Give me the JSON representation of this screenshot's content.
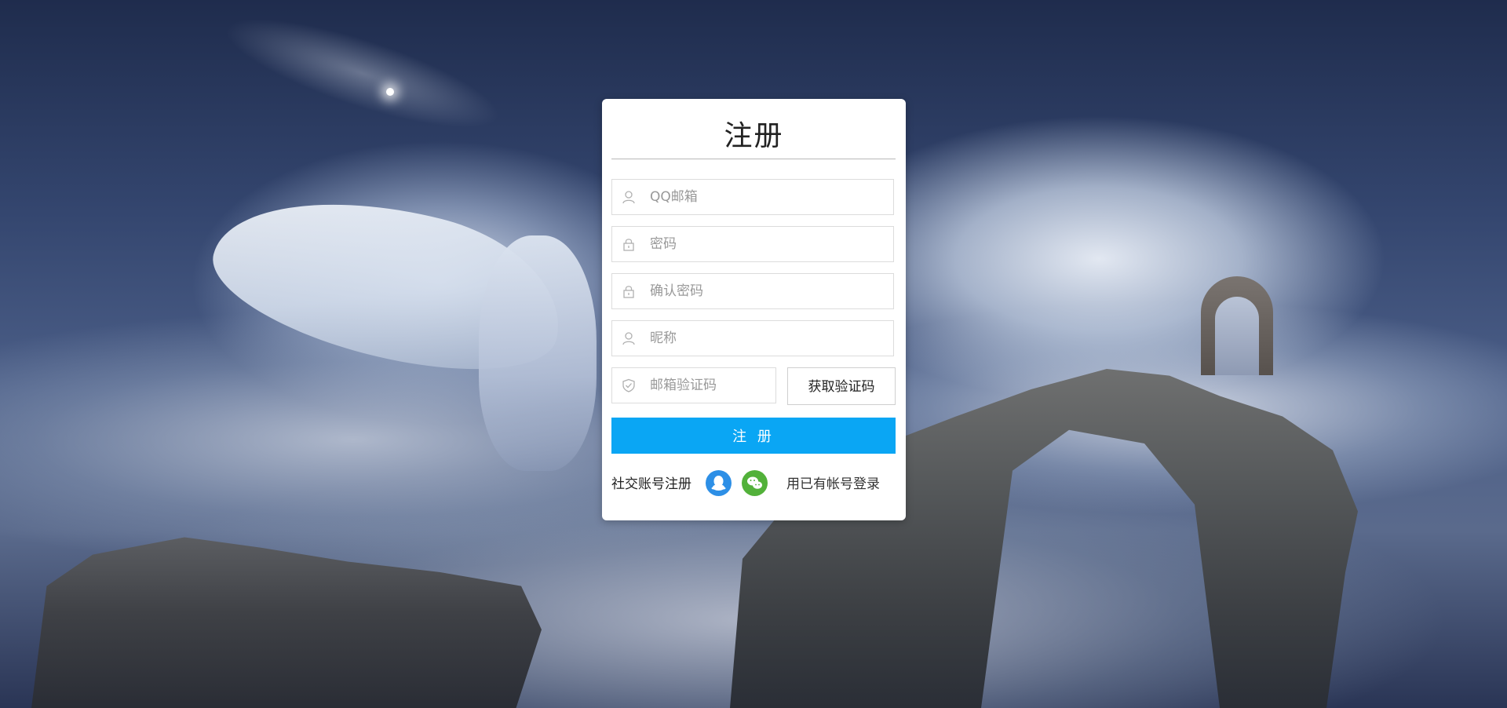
{
  "page": {
    "title": "注册"
  },
  "form": {
    "email_placeholder": "QQ邮箱",
    "password_placeholder": "密码",
    "confirm_password_placeholder": "确认密码",
    "nickname_placeholder": "昵称",
    "code_placeholder": "邮箱验证码",
    "get_code_label": "获取验证码",
    "submit_label": "注 册"
  },
  "footer": {
    "social_label": "社交账号注册",
    "social_icons": [
      "qq-icon",
      "wechat-icon"
    ],
    "login_link": "用已有帐号登录"
  },
  "colors": {
    "primary_button": "#0aa6f4",
    "qq": "#2d8fe6",
    "wechat": "#52b13a"
  }
}
